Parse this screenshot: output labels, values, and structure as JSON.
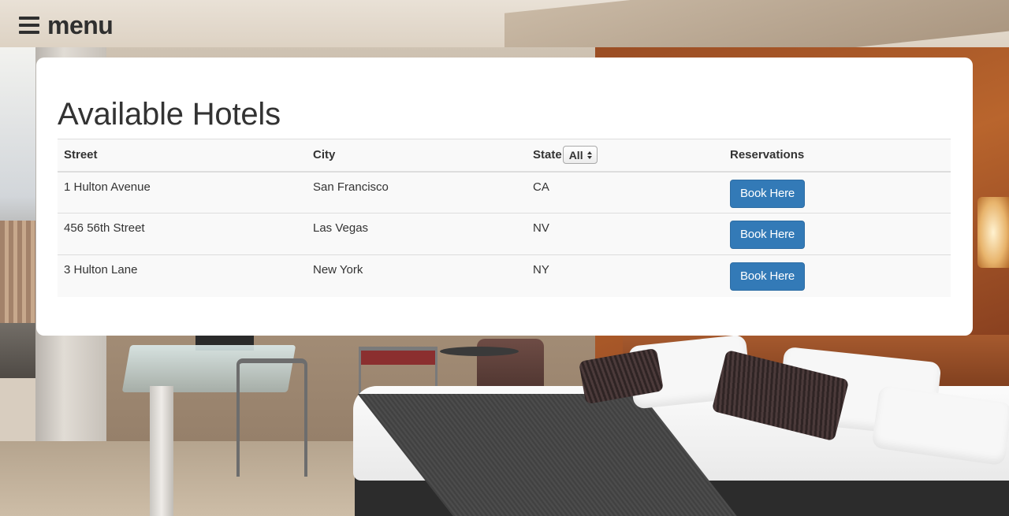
{
  "header": {
    "menu_label": "menu",
    "menu_icon": "hamburger-icon"
  },
  "main": {
    "title": "Available Hotels",
    "table": {
      "columns": [
        "Street",
        "City",
        "State",
        "Reservations"
      ],
      "state_filter": {
        "selected": "All"
      },
      "rows": [
        {
          "street": "1 Hulton Avenue",
          "city": "San Francisco",
          "state": "CA",
          "action": "Book Here"
        },
        {
          "street": "456 56th Street",
          "city": "Las Vegas",
          "state": "NV",
          "action": "Book Here"
        },
        {
          "street": "3 Hulton Lane",
          "city": "New York",
          "state": "NY",
          "action": "Book Here"
        }
      ]
    }
  },
  "colors": {
    "primary_button": "#337ab7",
    "card_background": "#ffffff",
    "table_stripe": "#f9f9f9"
  }
}
